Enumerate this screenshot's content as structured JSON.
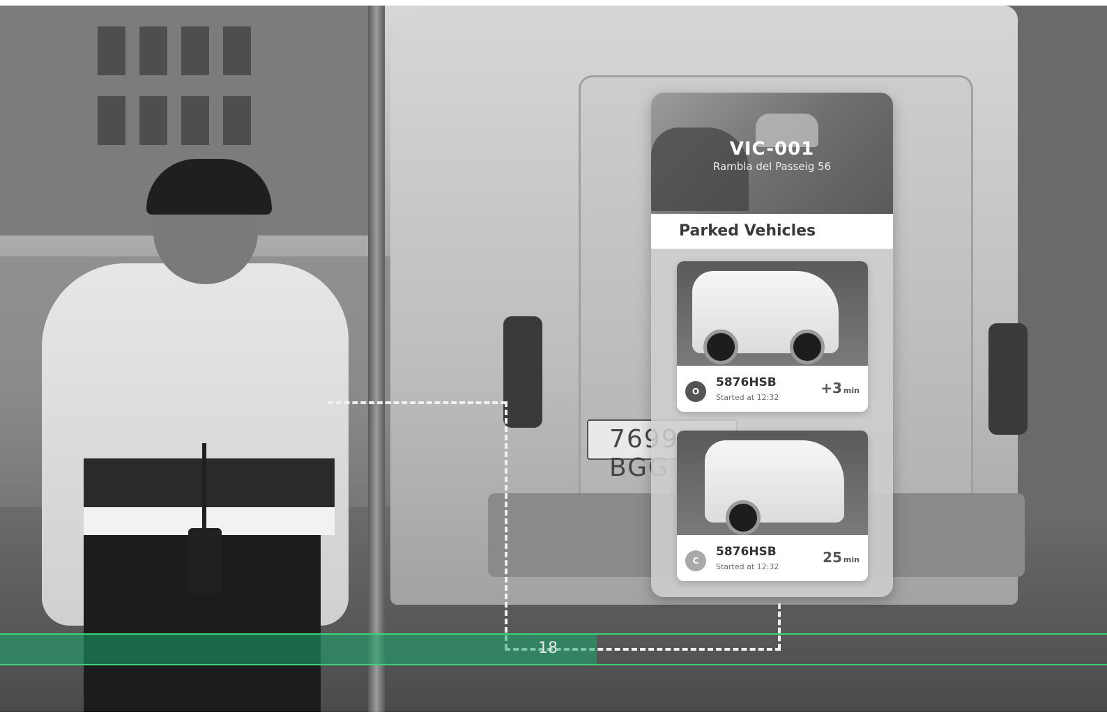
{
  "card": {
    "title": "VIC-001",
    "address": "Rambla del Passeig 56",
    "section_title": "Parked Vehicles",
    "vehicles": [
      {
        "status_letter": "O",
        "status_color": "#555555",
        "plate": "5876HSB",
        "started": "Started at 12:32",
        "duration_value": "+3",
        "duration_unit": "min"
      },
      {
        "status_letter": "C",
        "status_color": "#a9a9a9",
        "plate": "5876HSB",
        "started": "Started at 12:32",
        "duration_value": "25",
        "duration_unit": "min"
      }
    ]
  },
  "background": {
    "van_plate": "7699 BGG"
  },
  "footer": {
    "page_number": "18",
    "accent_color": "#3dd17c"
  }
}
